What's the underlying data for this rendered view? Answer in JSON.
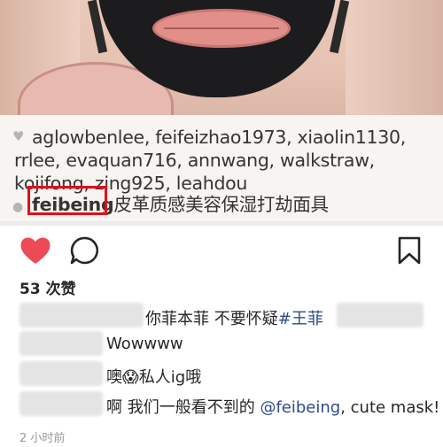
{
  "caption": {
    "likers_line1": "aglowbenlee, feifeizhao1973, xiaolin1130,",
    "likers_line2": "rrlee, evaquan716, annwang, walkstraw,",
    "likers_line3": "kojifong, zing925, leahdou",
    "caption_user": "feibeing",
    "caption_text": "皮革质感美容保湿打劫面具"
  },
  "actions": {
    "like_icon": "heart-filled-icon",
    "comment_icon": "comment-bubble-icon",
    "save_icon": "bookmark-icon",
    "like_color": "#ed4956"
  },
  "likes_count": "53 次赞",
  "comments": [
    {
      "prefix": "你菲本菲 不要怀疑",
      "tag": "#王菲"
    },
    {
      "text": "Wowwww"
    },
    {
      "text_a": "噢",
      "emoji": "😱",
      "text_b": "私人ig哦"
    },
    {
      "text_a": "啊 我们一般看不到的 ",
      "mention": "@feibeing",
      "text_b": ", cute mask!"
    }
  ],
  "timestamp": "2 小时前",
  "colors": {
    "highlight_box": "#e10f1a",
    "mention": "#2d4b8a"
  }
}
